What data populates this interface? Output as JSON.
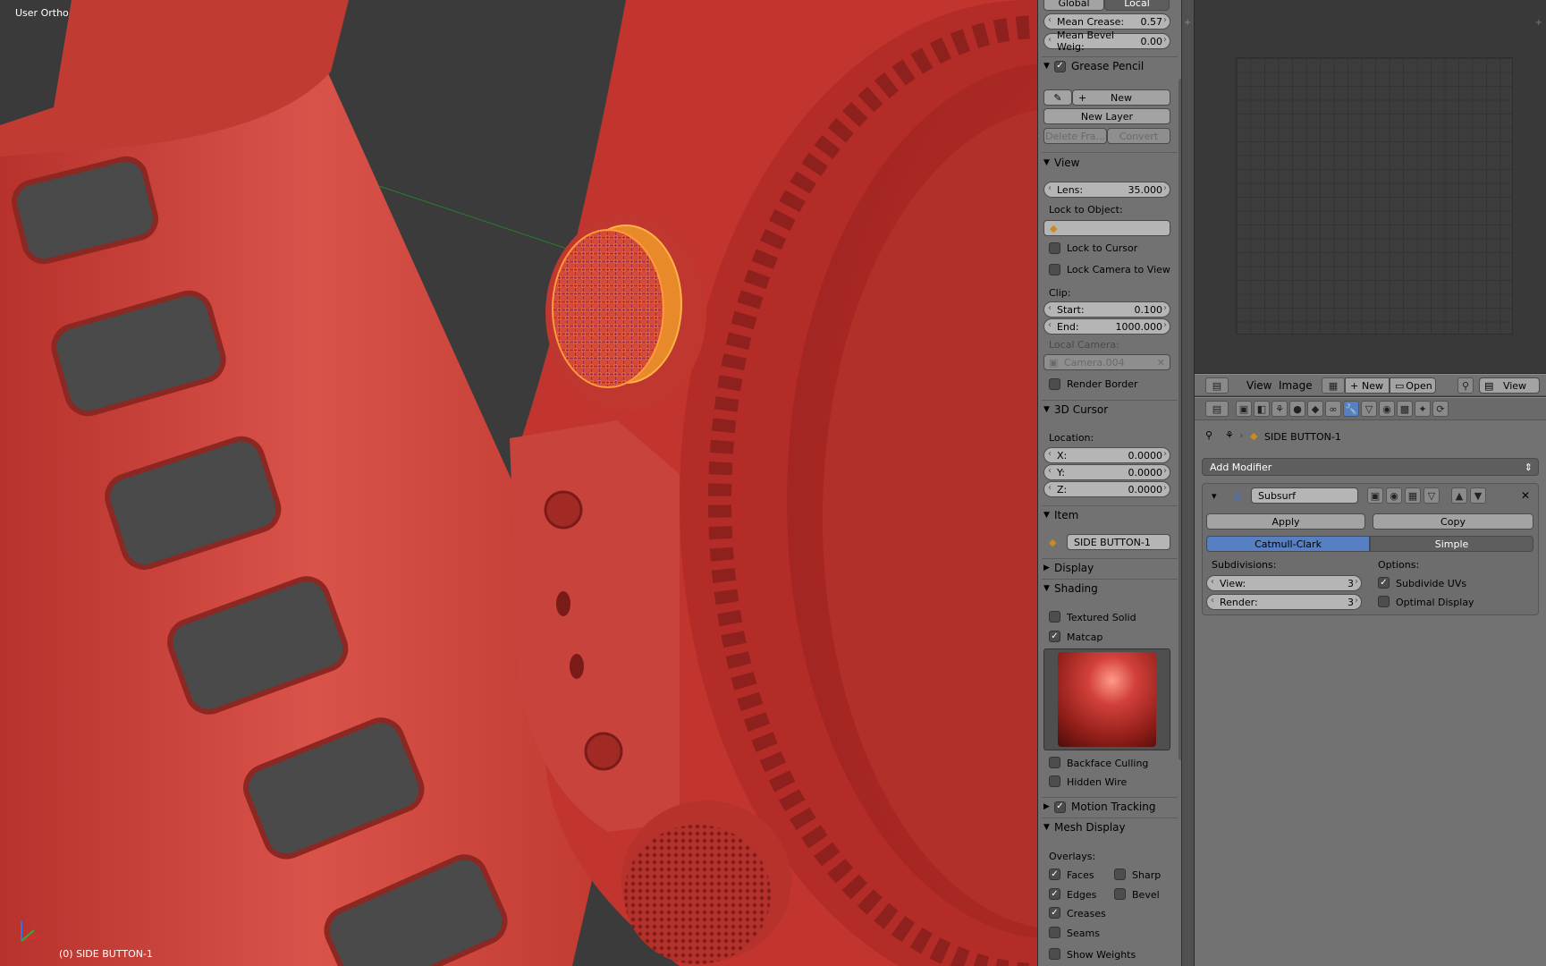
{
  "viewport": {
    "view_label": "User Ortho",
    "object_label": "(0) SIDE BUTTON-1"
  },
  "npanel": {
    "transform_orient": [
      "Global",
      "Local"
    ],
    "mean_crease": {
      "label": "Mean Crease:",
      "value": "0.57"
    },
    "mean_bevel": {
      "label": "Mean Bevel Weig:",
      "value": "0.00"
    },
    "grease_pencil": {
      "title": "Grease Pencil",
      "new_label": "New",
      "new_layer_label": "New Layer",
      "delete_frame_label": "Delete Fra...",
      "convert_label": "Convert"
    },
    "view": {
      "title": "View",
      "lens": {
        "label": "Lens:",
        "value": "35.000"
      },
      "lock_to_object_label": "Lock to Object:",
      "lock_to_cursor_label": "Lock to Cursor",
      "lock_camera_label": "Lock Camera to View",
      "clip_label": "Clip:",
      "clip_start": {
        "label": "Start:",
        "value": "0.100"
      },
      "clip_end": {
        "label": "End:",
        "value": "1000.000"
      },
      "local_camera_label": "Local Camera:",
      "local_camera_value": "Camera.004",
      "render_border_label": "Render Border"
    },
    "cursor": {
      "title": "3D Cursor",
      "location_label": "Location:",
      "x": {
        "label": "X:",
        "value": "0.0000"
      },
      "y": {
        "label": "Y:",
        "value": "0.0000"
      },
      "z": {
        "label": "Z:",
        "value": "0.0000"
      }
    },
    "item": {
      "title": "Item",
      "name": "SIDE BUTTON-1"
    },
    "display_title": "Display",
    "shading": {
      "title": "Shading",
      "textured_solid_label": "Textured Solid",
      "matcap_label": "Matcap",
      "backface_culling_label": "Backface Culling",
      "hidden_wire_label": "Hidden Wire"
    },
    "motion_tracking_title": "Motion Tracking",
    "mesh_display": {
      "title": "Mesh Display",
      "overlays_label": "Overlays:",
      "faces_label": "Faces",
      "sharp_label": "Sharp",
      "edges_label": "Edges",
      "bevel_label": "Bevel",
      "creases_label": "Creases",
      "seams_label": "Seams",
      "show_weights_label": "Show Weights"
    }
  },
  "image_editor_header": {
    "view_menu": "View",
    "image_menu": "Image",
    "new_label": "New",
    "open_label": "Open",
    "view_dropdown": "View"
  },
  "properties": {
    "object_name": "SIDE BUTTON-1",
    "add_modifier_label": "Add Modifier",
    "modifier": {
      "name": "Subsurf",
      "apply_label": "Apply",
      "copy_label": "Copy",
      "tabs": [
        "Catmull-Clark",
        "Simple"
      ],
      "subdivisions_label": "Subdivisions:",
      "view": {
        "label": "View:",
        "value": "3"
      },
      "render": {
        "label": "Render:",
        "value": "3"
      },
      "options_label": "Options:",
      "subdivide_uvs_label": "Subdivide UVs",
      "optimal_display_label": "Optimal Display"
    }
  },
  "colors": {
    "accent": "#5680c2",
    "panel": "#727272",
    "model": "#c83a34"
  }
}
